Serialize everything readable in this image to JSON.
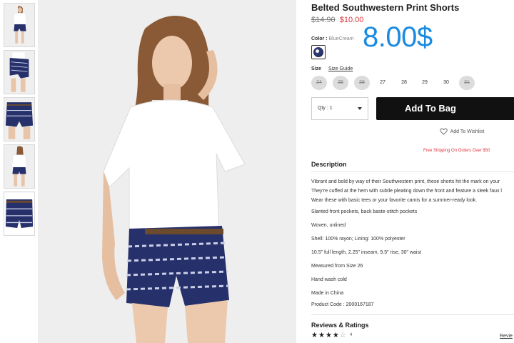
{
  "product": {
    "title": "Belted Southwestern Print Shorts",
    "old_price": "$14.90",
    "sale_price": "$10.00",
    "overlay_price": "8.00$",
    "code": "Product Code : 2000167187"
  },
  "color": {
    "label": "Color :",
    "value": "BlueCream",
    "swatch_color": "#2b3870"
  },
  "size": {
    "label": "Size",
    "guide_label": "Size Guide",
    "options": [
      {
        "label": "24",
        "available": false
      },
      {
        "label": "25",
        "available": false
      },
      {
        "label": "26",
        "available": false
      },
      {
        "label": "27",
        "available": true
      },
      {
        "label": "28",
        "available": true
      },
      {
        "label": "29",
        "available": true
      },
      {
        "label": "30",
        "available": true
      },
      {
        "label": "31",
        "available": false
      }
    ]
  },
  "purchase": {
    "qty_label": "Qty : 1",
    "add_to_bag": "Add To Bag",
    "wishlist": "Add To Wishlist",
    "shipping_note": "Free Shipping On Orders Over $50"
  },
  "description": {
    "title": "Description",
    "paragraph": [
      "Vibrant and bold by way of their Southwestern print, these shorts hit the mark on your",
      "They're cuffed at the hem with subtle pleating down the front and feature a sleek faux l",
      "Wear these with basic tees or your favorite camis for a summer-ready look."
    ],
    "details": [
      "Slanted front pockets, back baste-stitch pockets",
      "Woven, unlined",
      "Shell: 100% rayon; Lining: 100% polyester",
      "10.5\" full length, 2.25\" inseam, 9.5\" rise, 30\" waist",
      "Measured from Size 26",
      "Hand wash cold",
      "Made in China"
    ]
  },
  "reviews": {
    "title": "Reviews & Ratings",
    "rating": 4,
    "max_rating": 5,
    "count": "4",
    "link_label": "Revie"
  },
  "colors": {
    "sale_red": "#e0333a",
    "overlay_blue": "#1a8be0",
    "button_black": "#111111",
    "shorts_navy": "#26306a"
  }
}
